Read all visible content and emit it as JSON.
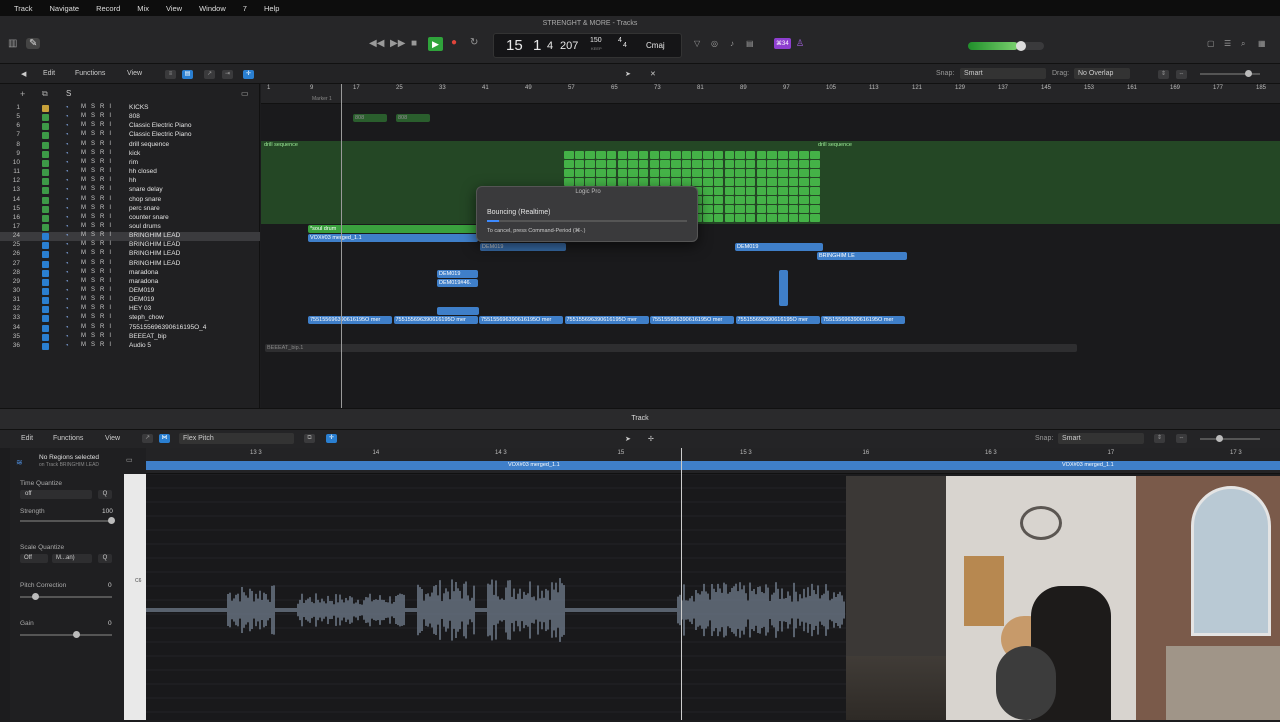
{
  "menu": [
    "Track",
    "Navigate",
    "Record",
    "Mix",
    "View",
    "Window",
    "7",
    "Help"
  ],
  "window_title": "STRENGHT & MORE - Tracks",
  "lcd": {
    "bar": "15",
    "beat": "1",
    "div": "4",
    "tick": "207",
    "tempo": "150",
    "keep": "KEEP",
    "sig_top": "4",
    "sig_bottom": "4",
    "key": "Cmaj"
  },
  "count_in": "⌘34",
  "tracks_toolbar": {
    "edit": "Edit",
    "functions": "Functions",
    "view": "View",
    "snap_label": "Snap:",
    "snap_value": "Smart",
    "drag_label": "Drag:",
    "drag_value": "No Overlap"
  },
  "ruler_marks": [
    "1",
    "9",
    "17",
    "25",
    "33",
    "41",
    "49",
    "57",
    "65",
    "73",
    "81",
    "89",
    "97",
    "105",
    "113",
    "121",
    "129",
    "137",
    "145",
    "153",
    "161",
    "169",
    "177",
    "185"
  ],
  "marker": "Marker 1",
  "tracks": [
    {
      "num": "1",
      "name": "KICKS"
    },
    {
      "num": "5",
      "name": "808"
    },
    {
      "num": "6",
      "name": "Classic Electric Piano"
    },
    {
      "num": "7",
      "name": "Classic Electric Piano"
    },
    {
      "num": "8",
      "name": "drill sequence"
    },
    {
      "num": "9",
      "name": "kick"
    },
    {
      "num": "10",
      "name": "rim"
    },
    {
      "num": "11",
      "name": "hh closed"
    },
    {
      "num": "12",
      "name": "hh"
    },
    {
      "num": "13",
      "name": "snare delay"
    },
    {
      "num": "14",
      "name": "chop snare"
    },
    {
      "num": "15",
      "name": "perc snare"
    },
    {
      "num": "16",
      "name": "counter snare"
    },
    {
      "num": "17",
      "name": "soul drums"
    },
    {
      "num": "24",
      "name": "BRINGHIM LEAD"
    },
    {
      "num": "25",
      "name": "BRINGHIM LEAD"
    },
    {
      "num": "26",
      "name": "BRINGHIM LEAD"
    },
    {
      "num": "27",
      "name": "BRINGHIM LEAD"
    },
    {
      "num": "28",
      "name": "maradona"
    },
    {
      "num": "29",
      "name": "maradona"
    },
    {
      "num": "30",
      "name": "DEM019"
    },
    {
      "num": "31",
      "name": "DEM019"
    },
    {
      "num": "32",
      "name": "HEY 03"
    },
    {
      "num": "33",
      "name": "steph_chow"
    },
    {
      "num": "34",
      "name": "755155696390616195O_4"
    },
    {
      "num": "35",
      "name": "BEEEAT_bip"
    },
    {
      "num": "36",
      "name": "Audio 5"
    }
  ],
  "regions": {
    "r808": "808",
    "drill": "drill sequence",
    "soul": "*soul drum",
    "vox": "VOX#03 merged_1.1",
    "dem": "DEM019",
    "dem2": "DEM019#46.",
    "brin": "BRINGHIM LE",
    "steph": "755155696390616195O mer",
    "beeeat": "BEEEAT_bip.1"
  },
  "dialog": {
    "title": "Logic Pro",
    "status": "Bouncing (Realtime)",
    "hint": "To cancel, press Command-Period (⌘-.)"
  },
  "divider_title": "Track",
  "editor_toolbar": {
    "edit": "Edit",
    "functions": "Functions",
    "view": "View",
    "mode": "Flex Pitch",
    "snap_label": "Snap:",
    "snap_value": "Smart"
  },
  "inspector": {
    "no_regions": "No Regions selected",
    "on_track": "on Track BRINGHIM LEAD",
    "time_quantize": "Time Quantize",
    "tq_value": "off",
    "q": "Q",
    "strength": "Strength",
    "strength_value": "100",
    "scale_quantize": "Scale Quantize",
    "sq_off": "Off",
    "sq_mode": "M...an)",
    "pitch_correction": "Pitch Correction",
    "pc_value": "0",
    "gain": "Gain",
    "gain_value": "0"
  },
  "editor_ruler": [
    "13 3",
    "14",
    "14 3",
    "15",
    "15 3",
    "16",
    "16 3",
    "17",
    "17 3"
  ],
  "editor_region": "VOX#03 merged_1.1",
  "keyboard_label": "C6",
  "playhead_progress": 0.38
}
